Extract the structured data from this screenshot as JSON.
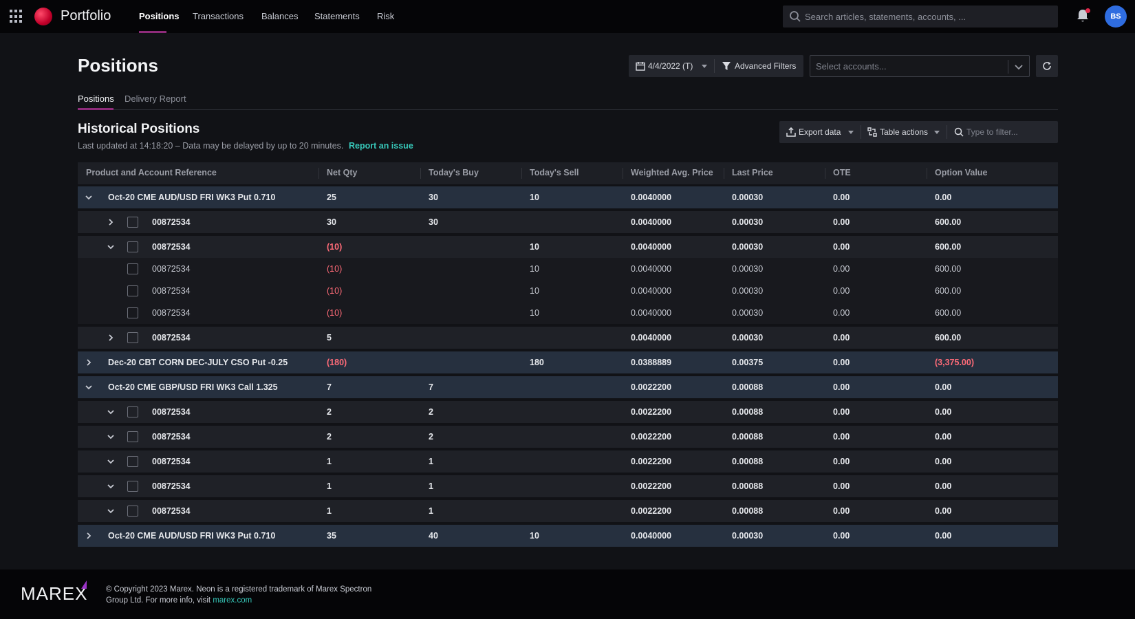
{
  "app": {
    "title": "Portfolio",
    "user_initials": "BS"
  },
  "nav": {
    "items": [
      "Positions",
      "Transactions",
      "Balances",
      "Statements",
      "Risk"
    ],
    "active": "Positions"
  },
  "search": {
    "placeholder": "Search articles, statements, accounts, ..."
  },
  "page": {
    "title": "Positions"
  },
  "toolbar": {
    "date": "4/4/2022 (T)",
    "advanced_filters": "Advanced Filters",
    "account_placeholder": "Select accounts..."
  },
  "tabs": [
    "Positions",
    "Delivery Report"
  ],
  "section": {
    "title": "Historical Positions",
    "updated": "Last updated at 14:18:20 – Data may be delayed by up to 20 minutes.",
    "report_link": "Report an issue"
  },
  "table_tools": {
    "export": "Export data",
    "actions": "Table actions",
    "filter_placeholder": "Type to filter..."
  },
  "table": {
    "columns": [
      "Product and Account Reference",
      "Net Qty",
      "Today's Buy",
      "Today's Sell",
      "Weighted Avg. Price",
      "Last Price",
      "OTE",
      "Option Value"
    ],
    "rows": [
      {
        "level": 0,
        "expander": "down",
        "checkbox": false,
        "cells": [
          "Oct-20 CME AUD/USD FRI WK3 Put 0.710",
          "25",
          "30",
          "10",
          "0.0040000",
          "0.00030",
          "0.00",
          "0.00"
        ]
      },
      {
        "level": 1,
        "expander": "right",
        "checkbox": true,
        "cells": [
          "00872534",
          "30",
          "30",
          "",
          "0.0040000",
          "0.00030",
          "0.00",
          "600.00"
        ]
      },
      {
        "level": 1,
        "expander": "down",
        "checkbox": true,
        "cells": [
          "00872534",
          "(10)",
          "",
          "10",
          "0.0040000",
          "0.00030",
          "0.00",
          "600.00"
        ]
      },
      {
        "level": 2,
        "expander": "none",
        "checkbox": true,
        "cells": [
          "00872534",
          "(10)",
          "",
          "10",
          "0.0040000",
          "0.00030",
          "0.00",
          "600.00"
        ]
      },
      {
        "level": 2,
        "expander": "none",
        "checkbox": true,
        "cells": [
          "00872534",
          "(10)",
          "",
          "10",
          "0.0040000",
          "0.00030",
          "0.00",
          "600.00"
        ]
      },
      {
        "level": 2,
        "expander": "none",
        "checkbox": true,
        "cells": [
          "00872534",
          "(10)",
          "",
          "10",
          "0.0040000",
          "0.00030",
          "0.00",
          "600.00"
        ]
      },
      {
        "level": 1,
        "expander": "right",
        "checkbox": true,
        "cells": [
          "00872534",
          "5",
          "",
          "",
          "0.0040000",
          "0.00030",
          "0.00",
          "600.00"
        ]
      },
      {
        "level": 0,
        "expander": "right",
        "checkbox": false,
        "cells": [
          "Dec-20 CBT CORN DEC-JULY CSO Put -0.25",
          "(180)",
          "",
          "180",
          "0.0388889",
          "0.00375",
          "0.00",
          "(3,375.00)"
        ]
      },
      {
        "level": 0,
        "expander": "down",
        "checkbox": false,
        "cells": [
          "Oct-20 CME GBP/USD FRI WK3 Call 1.325",
          "7",
          "7",
          "",
          "0.0022200",
          "0.00088",
          "0.00",
          "0.00"
        ]
      },
      {
        "level": 1,
        "expander": "down",
        "checkbox": true,
        "cells": [
          "00872534",
          "2",
          "2",
          "",
          "0.0022200",
          "0.00088",
          "0.00",
          "0.00"
        ]
      },
      {
        "level": 1,
        "expander": "down",
        "checkbox": true,
        "cells": [
          "00872534",
          "2",
          "2",
          "",
          "0.0022200",
          "0.00088",
          "0.00",
          "0.00"
        ]
      },
      {
        "level": 1,
        "expander": "down",
        "checkbox": true,
        "cells": [
          "00872534",
          "1",
          "1",
          "",
          "0.0022200",
          "0.00088",
          "0.00",
          "0.00"
        ]
      },
      {
        "level": 1,
        "expander": "down",
        "checkbox": true,
        "cells": [
          "00872534",
          "1",
          "1",
          "",
          "0.0022200",
          "0.00088",
          "0.00",
          "0.00"
        ]
      },
      {
        "level": 1,
        "expander": "down",
        "checkbox": true,
        "cells": [
          "00872534",
          "1",
          "1",
          "",
          "0.0022200",
          "0.00088",
          "0.00",
          "0.00"
        ]
      },
      {
        "level": 0,
        "expander": "right",
        "checkbox": false,
        "cells": [
          "Oct-20 CME AUD/USD FRI WK3 Put 0.710",
          "35",
          "40",
          "10",
          "0.0040000",
          "0.00030",
          "0.00",
          "0.00"
        ]
      }
    ]
  },
  "footer": {
    "logo_text": "MAREX",
    "copyright": "© Copyright 2023 Marex. Neon is a registered trademark of Marex Spectron Group Ltd. For more info, visit",
    "link": "marex.com"
  },
  "colors": {
    "accent": "#8e2b7a",
    "link": "#37c7b9",
    "negative": "#ff6b78",
    "avatar": "#2f6de0",
    "group_row": "#26303f"
  }
}
